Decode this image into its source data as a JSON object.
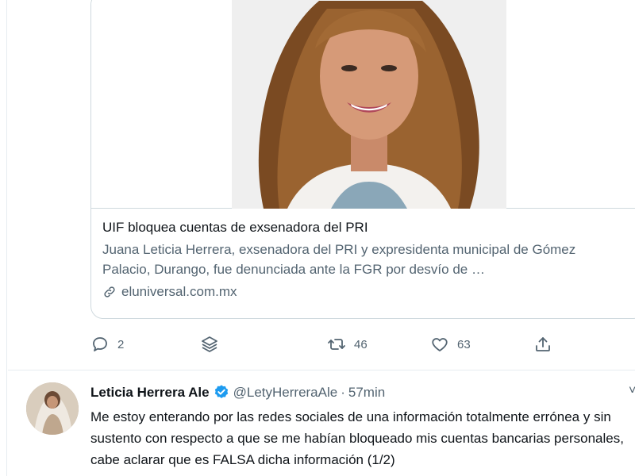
{
  "link_card": {
    "title": "UIF bloquea cuentas de exsenadora del PRI",
    "description": "Juana Leticia Herrera, exsenadora del PRI y expresidenta municipal de Gómez Palacio, Durango, fue denunciada ante la FGR por desvío de …",
    "domain": "eluniversal.com.mx",
    "domain_icon": "link-icon"
  },
  "actions": {
    "reply_count": "2",
    "retweet_count": "46",
    "like_count": "63",
    "icons": [
      "reply-icon",
      "layers-icon",
      "retweet-icon",
      "heart-icon",
      "share-icon"
    ]
  },
  "next_tweet": {
    "display_name": "Leticia Herrera Ale",
    "handle": "@LetyHerreraAle",
    "separator": "·",
    "time": "57min",
    "text": "Me estoy enterando por las redes sociales de una información totalmente errónea y sin sustento con respecto a que se me habían bloqueado mis cuentas bancarias personales, cabe aclarar que es FALSA dicha información (1/2)"
  },
  "colors": {
    "border": "#cfd9de",
    "secondary_text": "#536471",
    "verified_blue": "#1d9bf0"
  }
}
